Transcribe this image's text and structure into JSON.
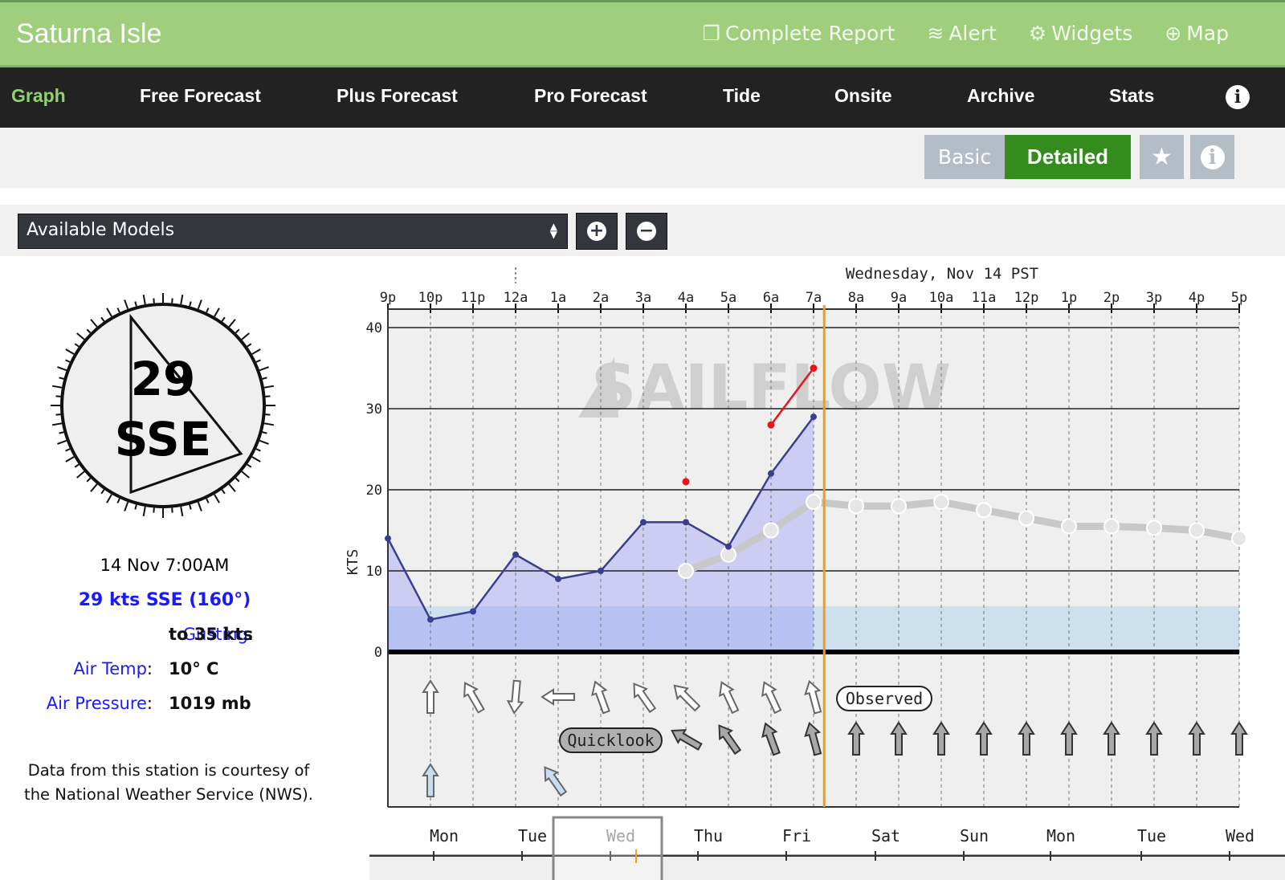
{
  "header": {
    "title": "Saturna Isle",
    "links": [
      {
        "label": "Complete Report",
        "icon": "window-icon"
      },
      {
        "label": "Alert",
        "icon": "wifi-alert-icon"
      },
      {
        "label": "Widgets",
        "icon": "gear-icon"
      },
      {
        "label": "Map",
        "icon": "crosshair-icon"
      }
    ]
  },
  "nav": {
    "items": [
      "Graph",
      "Free Forecast",
      "Plus Forecast",
      "Pro Forecast",
      "Tide",
      "Onsite",
      "Archive",
      "Stats"
    ],
    "active": "Graph"
  },
  "toolbar": {
    "basic": "Basic",
    "detailed": "Detailed",
    "active": "Detailed"
  },
  "models": {
    "select_value": "Available Models"
  },
  "station": {
    "compass_speed": "29",
    "compass_dir": "SSE",
    "time": "14 Nov 7:00AM",
    "wind": "29 kts SSE (160°)",
    "gust_label": "Gusting",
    "gust_value": "to 35 kts",
    "temp_label": "Air Temp",
    "temp_value": "10° C",
    "pressure_label": "Air Pressure",
    "pressure_value": "1019 mb",
    "credit_1": "Data from this station is courtesy of",
    "credit_2": "the National Weather Service (NWS)."
  },
  "colors": {
    "header": "#9fcf7c",
    "nav": "#222222",
    "detailed": "#358c1e",
    "observed": "#3a3f8f",
    "gust": "#e8141e",
    "forecast": "#c8c8c8",
    "now": "#f59a1c"
  },
  "chart_data": {
    "type": "line",
    "title": "Wednesday, Nov 14 PST",
    "ylabel": "KTS",
    "ylim": [
      0,
      40
    ],
    "yticks": [
      0,
      10,
      20,
      30,
      40
    ],
    "x": [
      "9p",
      "10p",
      "11p",
      "12a",
      "1a",
      "2a",
      "3a",
      "4a",
      "5a",
      "6a",
      "7a",
      "8a",
      "9a",
      "10a",
      "11a",
      "12p",
      "1p",
      "2p",
      "3p",
      "4p",
      "5p"
    ],
    "now_marker": "7:15a",
    "watermark": "SAILFLOW",
    "series": [
      {
        "key": "observed",
        "x": [
          "9p",
          "10p",
          "11p",
          "12a",
          "1a",
          "2a",
          "3a",
          "4a",
          "5a",
          "6a",
          "7a"
        ],
        "values": [
          14,
          4,
          5,
          12,
          9,
          10,
          16,
          16,
          13,
          22,
          29
        ]
      },
      {
        "key": "gust",
        "x": [
          "4a",
          "6a",
          "7a"
        ],
        "values": [
          21,
          28,
          35
        ]
      },
      {
        "key": "forecast",
        "x": [
          "4a",
          "5a",
          "6a",
          "7a",
          "8a",
          "9a",
          "10a",
          "11a",
          "12p",
          "1p",
          "2p",
          "3p",
          "4p",
          "5p"
        ],
        "values": [
          10,
          12,
          15,
          18.5,
          18,
          18,
          18.5,
          17.5,
          16.5,
          15.5,
          15.5,
          15.3,
          15,
          14
        ]
      }
    ],
    "direction_rows": [
      {
        "label": "Observed",
        "style": "white",
        "x": [
          "10p",
          "11p",
          "12a",
          "1a",
          "2a",
          "3a",
          "4a",
          "5a",
          "6a",
          "7a"
        ],
        "rotation_deg": [
          0,
          -30,
          185,
          -90,
          -20,
          -35,
          -45,
          -25,
          -25,
          -15
        ]
      },
      {
        "label": "Quicklook",
        "style": "gray",
        "x": [
          "4a",
          "5a",
          "6a",
          "7a",
          "8a",
          "9a",
          "10a",
          "11a",
          "12p",
          "1p",
          "2p",
          "3p",
          "4p",
          "5p"
        ],
        "rotation_deg": [
          -60,
          -35,
          -20,
          -15,
          0,
          0,
          0,
          0,
          0,
          0,
          0,
          0,
          0,
          0
        ]
      },
      {
        "label": "",
        "style": "blue",
        "x": [
          "10p",
          "1a"
        ],
        "rotation_deg": [
          0,
          -35
        ]
      }
    ],
    "timeline": {
      "days": [
        "Mon",
        "Tue",
        "Wed",
        "Thu",
        "Fri",
        "Sat",
        "Sun",
        "Mon",
        "Tue",
        "Wed"
      ],
      "selected": "Wed"
    }
  }
}
